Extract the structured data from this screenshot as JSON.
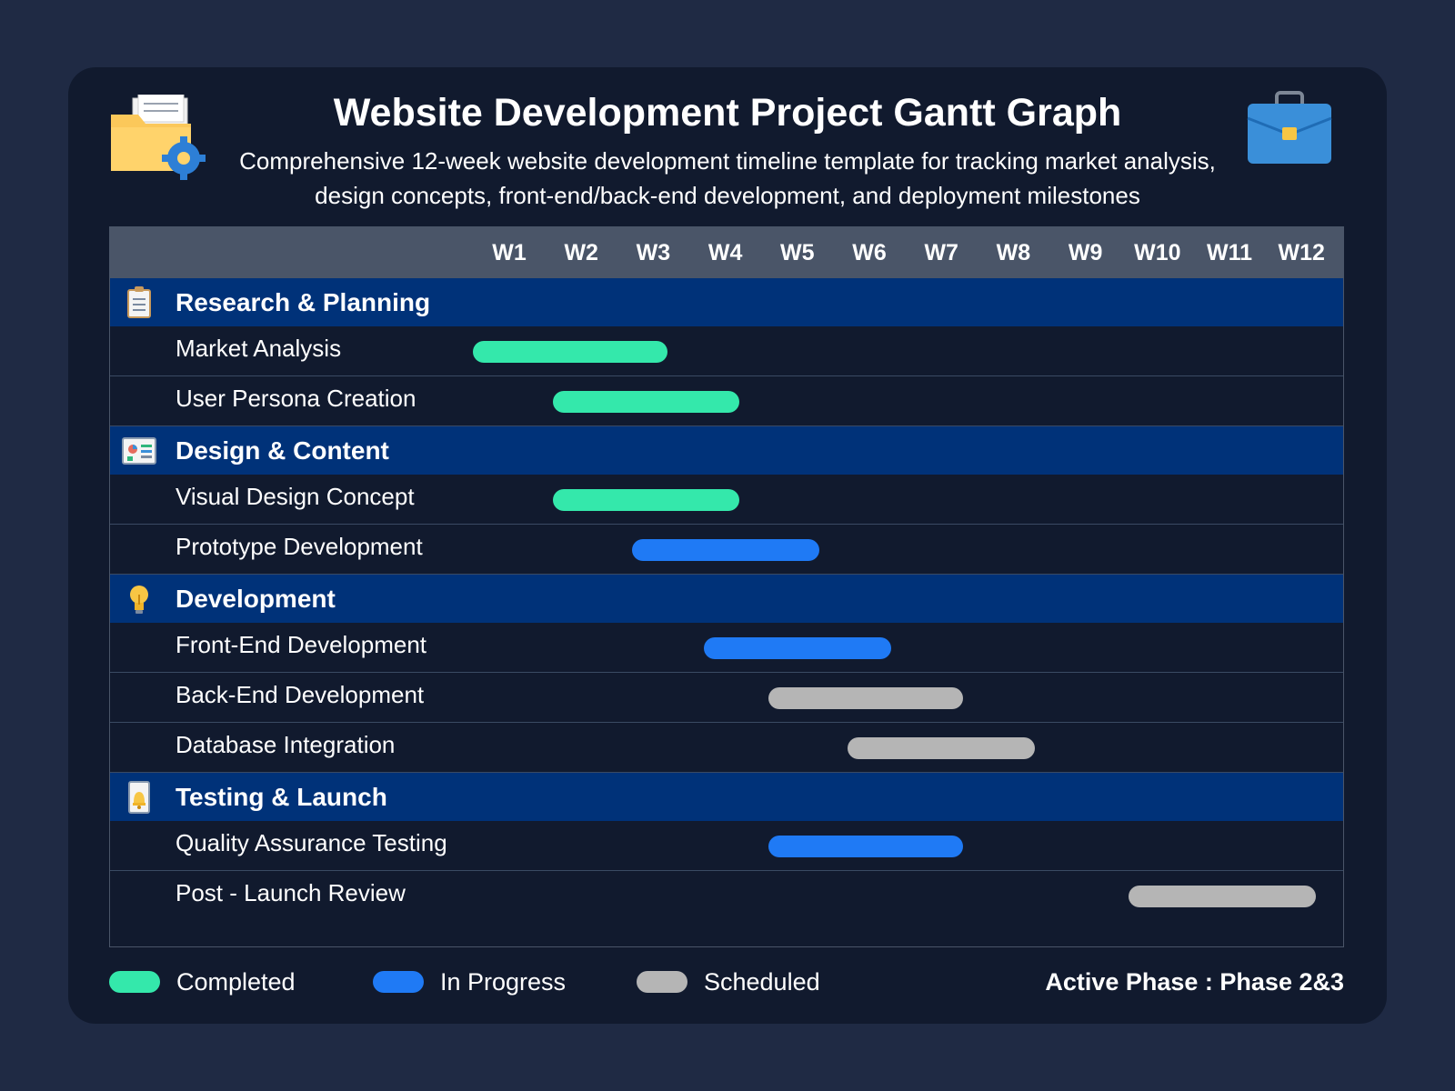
{
  "header": {
    "title": "Website Development Project Gantt Graph",
    "subtitle": "Comprehensive 12-week website development timeline template for tracking market analysis, design concepts, front-end/back-end development, and deployment milestones",
    "left_icon": "folder-gear-icon",
    "right_icon": "briefcase-icon"
  },
  "colors": {
    "Completed": "#34e8ab",
    "In Progress": "#1f7af5",
    "Scheduled": "#b5b5b5",
    "category_bg": "#003279",
    "header_bg": "#4a5568"
  },
  "chart_data": {
    "type": "gantt",
    "weeks": [
      "W1",
      "W2",
      "W3",
      "W4",
      "W5",
      "W6",
      "W7",
      "W8",
      "W9",
      "W10",
      "W11",
      "W12"
    ],
    "groups": [
      {
        "name": "Research & Planning",
        "icon": "clipboard-icon",
        "tasks": [
          {
            "name": "Market Analysis",
            "start": 1,
            "end": 2.8,
            "status": "Completed"
          },
          {
            "name": "User Persona Creation",
            "start": 2.1,
            "end": 3.8,
            "status": "Completed"
          }
        ]
      },
      {
        "name": "Design & Content",
        "icon": "dashboard-icon",
        "tasks": [
          {
            "name": "Visual Design Concept",
            "start": 2.1,
            "end": 3.8,
            "status": "Completed"
          },
          {
            "name": "Prototype Development",
            "start": 3.2,
            "end": 4.9,
            "status": "In Progress"
          }
        ]
      },
      {
        "name": "Development",
        "icon": "lightbulb-icon",
        "tasks": [
          {
            "name": "Front-End Development",
            "start": 4.2,
            "end": 5.9,
            "status": "In Progress"
          },
          {
            "name": "Back-End Development",
            "start": 5.1,
            "end": 6.9,
            "status": "Scheduled"
          },
          {
            "name": "Database Integration",
            "start": 6.2,
            "end": 7.9,
            "status": "Scheduled"
          }
        ]
      },
      {
        "name": "Testing & Launch",
        "icon": "bell-note-icon",
        "tasks": [
          {
            "name": "Quality Assurance Testing",
            "start": 5.1,
            "end": 6.9,
            "status": "In Progress"
          },
          {
            "name": "Post - Launch Review",
            "start": 10.1,
            "end": 11.8,
            "status": "Scheduled"
          }
        ]
      }
    ],
    "legend": [
      "Completed",
      "In Progress",
      "Scheduled"
    ],
    "legend_position": "bottom-left"
  },
  "footer": {
    "active_phase": "Active Phase : Phase 2&3"
  }
}
